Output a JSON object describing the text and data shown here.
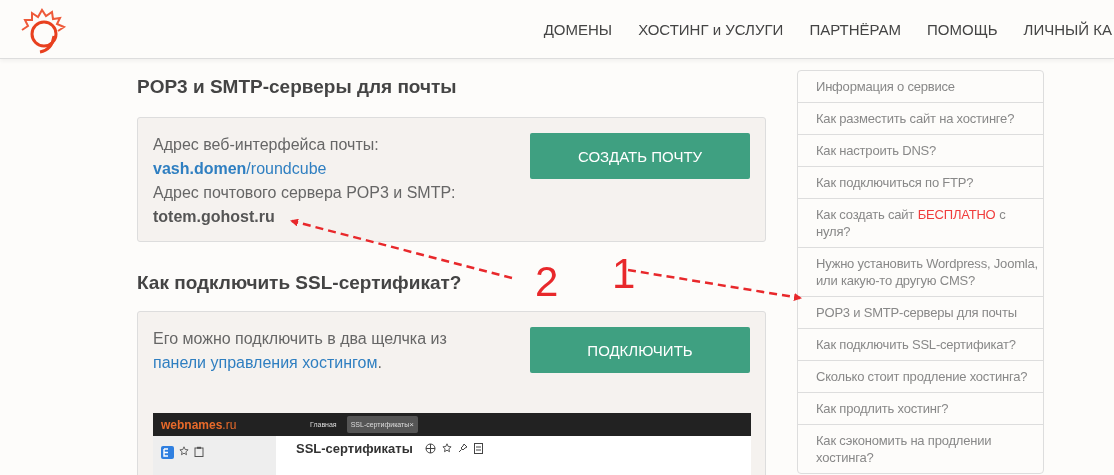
{
  "header": {
    "nav": [
      {
        "label": "ДОМЕНЫ"
      },
      {
        "label": "ХОСТИНГ и УСЛУГИ"
      },
      {
        "label": "ПАРТНЁРАМ"
      },
      {
        "label": "ПОМОЩЬ"
      },
      {
        "label": "ЛИЧНЫЙ КА"
      }
    ]
  },
  "sections": [
    {
      "title": "POP3 и SMTP-серверы для почты",
      "button": "СОЗДАТЬ ПОЧТУ",
      "lines": [
        {
          "kind": "label",
          "text": "Адрес веб-интерфейса почты:"
        },
        {
          "kind": "link",
          "text": "**vash.domen**/roundcube"
        },
        {
          "kind": "label",
          "text": "Адрес почтового сервера POP3 и SMTP:"
        },
        {
          "kind": "strong",
          "text": "totem.gohost.ru"
        }
      ]
    },
    {
      "title": "Как подключить SSL-сертификат?",
      "button": "ПОДКЛЮЧИТЬ",
      "text": "Его можно подключить в два щелчка из",
      "link": "панели управления хостингом",
      "after": ".",
      "inset": {
        "brand": "webnames",
        "brand_suffix": ".ru",
        "tabs": [
          {
            "label": "Главная",
            "selected": false
          },
          {
            "label": "SSL-сертификаты",
            "selected": true,
            "close": "×"
          }
        ],
        "page_title": "SSL-сертификаты"
      }
    }
  ],
  "sidebar": {
    "items": [
      {
        "parts": [
          {
            "text": "Информация о сервисе",
            "highlight": false
          }
        ]
      },
      {
        "parts": [
          {
            "text": "Как разместить сайт на хостинге?",
            "highlight": false
          }
        ]
      },
      {
        "parts": [
          {
            "text": "Как настроить DNS?",
            "highlight": false
          }
        ]
      },
      {
        "parts": [
          {
            "text": "Как подключиться по FTP?",
            "highlight": false
          }
        ]
      },
      {
        "parts": [
          {
            "text": "Как создать сайт",
            "highlight": false
          },
          {
            "text": "БЕСПЛАТНО",
            "highlight": true
          },
          {
            "text": "с нуля?",
            "highlight": false
          }
        ]
      },
      {
        "parts": [
          {
            "text": "Нужно установить Wordpress, Joomla, или какую-то другую CMS?",
            "highlight": false
          }
        ]
      },
      {
        "parts": [
          {
            "text": "POP3 и SMTP-серверы для почты",
            "highlight": false
          }
        ]
      },
      {
        "parts": [
          {
            "text": "Как подключить SSL-сертификат?",
            "highlight": false
          }
        ]
      },
      {
        "parts": [
          {
            "text": "Сколько стоит продление хостинга?",
            "highlight": false
          }
        ]
      },
      {
        "parts": [
          {
            "text": "Как продлить хостинг?",
            "highlight": false
          }
        ]
      },
      {
        "parts": [
          {
            "text": "Как сэкономить на продлении хостинга?",
            "highlight": false
          }
        ]
      }
    ]
  },
  "annotations": [
    {
      "label": "2"
    },
    {
      "label": "1"
    }
  ]
}
